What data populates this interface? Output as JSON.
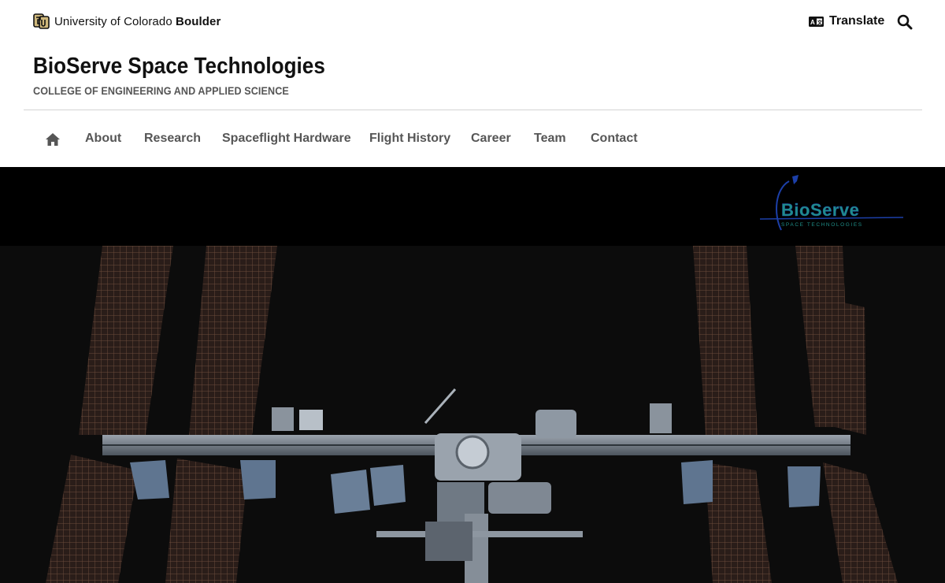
{
  "topbar": {
    "university_regular": "University of Colorado ",
    "university_bold": "Boulder",
    "translate_label": "Translate",
    "icons": {
      "logo": "cu-boulder-logo-icon",
      "translate": "translate-icon",
      "search": "search-icon"
    }
  },
  "header": {
    "title": "BioServe Space Technologies",
    "subtitle": "COLLEGE OF ENGINEERING AND APPLIED SCIENCE"
  },
  "nav": {
    "home_icon": "home-icon",
    "items": [
      {
        "label": "About"
      },
      {
        "label": "Research"
      },
      {
        "label": "Spaceflight Hardware"
      },
      {
        "label": "Flight History"
      },
      {
        "label": "Career"
      },
      {
        "label": "Team"
      },
      {
        "label": "Contact"
      }
    ]
  },
  "hero": {
    "logo_text": "BioServe",
    "logo_tagline": "SPACE TECHNOLOGIES",
    "colors": {
      "logo_teal": "#1f8f89",
      "logo_blue": "#1c3fa8",
      "panel_copper": "#6b4a3a"
    }
  },
  "colors": {
    "nav_text": "#565656",
    "title_text": "#111111",
    "subtitle_text": "#555555",
    "divider": "#d4d4d4"
  }
}
